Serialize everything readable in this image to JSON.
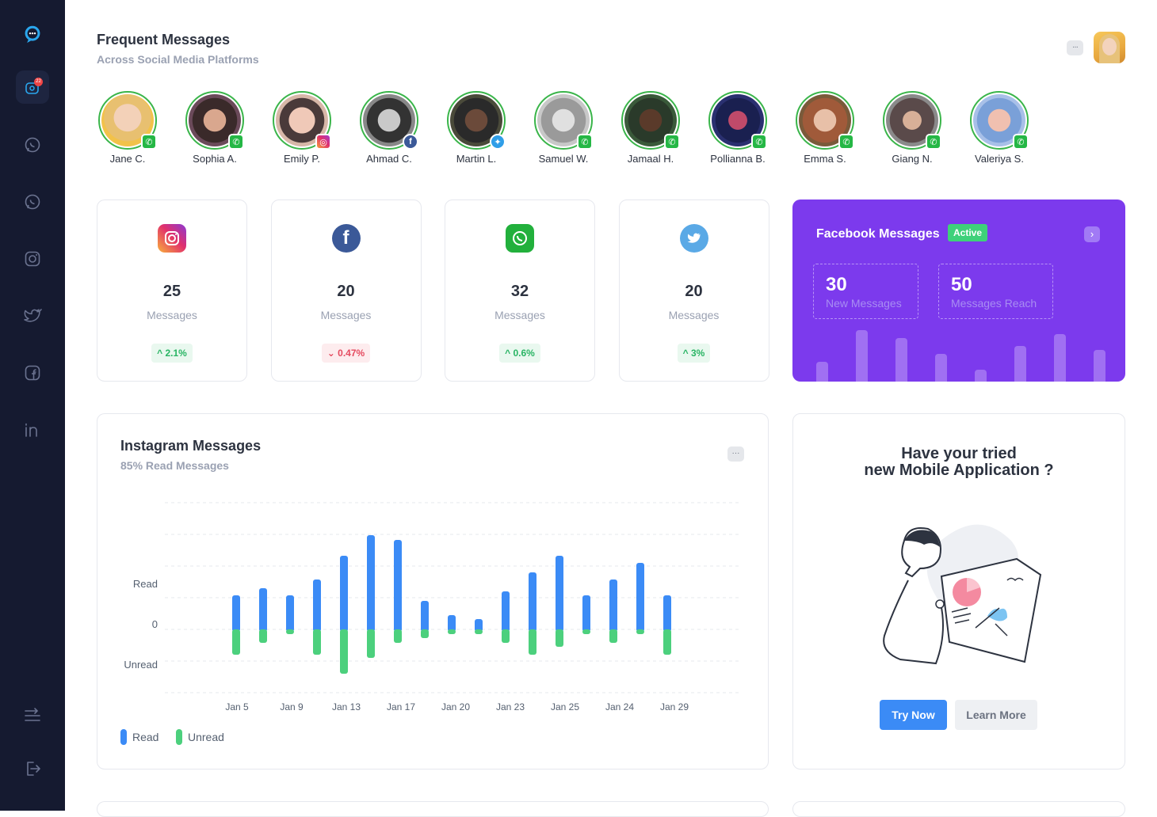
{
  "header": {
    "title": "Frequent Messages",
    "subtitle": "Across Social Media Platforms",
    "menu_label": "···"
  },
  "sidebar": {
    "notification_count": "22"
  },
  "contacts": [
    {
      "name": "Jane C.",
      "platform": "whatsapp"
    },
    {
      "name": "Sophia A.",
      "platform": "whatsapp"
    },
    {
      "name": "Emily P.",
      "platform": "instagram"
    },
    {
      "name": "Ahmad C.",
      "platform": "facebook"
    },
    {
      "name": "Martin L.",
      "platform": "twitter"
    },
    {
      "name": "Samuel W.",
      "platform": "whatsapp"
    },
    {
      "name": "Jamaal H.",
      "platform": "whatsapp"
    },
    {
      "name": "Pollianna B.",
      "platform": "whatsapp"
    },
    {
      "name": "Emma S.",
      "platform": "whatsapp"
    },
    {
      "name": "Giang N.",
      "platform": "whatsapp"
    },
    {
      "name": "Valeriya S.",
      "platform": "whatsapp"
    }
  ],
  "stats": [
    {
      "platform": "instagram",
      "count": "25",
      "label": "Messages",
      "change": "2.1%",
      "direction": "up"
    },
    {
      "platform": "facebook",
      "count": "20",
      "label": "Messages",
      "change": "0.47%",
      "direction": "down"
    },
    {
      "platform": "whatsapp",
      "count": "32",
      "label": "Messages",
      "change": "0.6%",
      "direction": "up"
    },
    {
      "platform": "twitter",
      "count": "20",
      "label": "Messages",
      "change": "3%",
      "direction": "up"
    }
  ],
  "facebook_card": {
    "title": "Facebook Messages",
    "status": "Active",
    "new_messages": "30",
    "new_messages_label": "New Messages",
    "reach": "50",
    "reach_label": "Messages Reach",
    "bars": [
      25,
      65,
      55,
      35,
      15,
      45,
      60,
      40
    ]
  },
  "chart": {
    "title": "Instagram Messages",
    "subtitle": "85% Read Messages",
    "menu_label": "···",
    "legend_read": "Read",
    "legend_unread": "Unread"
  },
  "chart_data": {
    "type": "bar",
    "x_tick_labels": [
      "Jan 5",
      "Jan 9",
      "Jan 13",
      "Jan 17",
      "Jan 20",
      "Jan 23",
      "Jan 25",
      "Jan 24",
      "Jan 29"
    ],
    "y_tick_labels": [
      "Read",
      "0",
      "Unread"
    ],
    "series": [
      {
        "name": "Read",
        "color": "#3b8bf6",
        "values": [
          43,
          52,
          43,
          63,
          93,
          119,
          113,
          36,
          18,
          13,
          48,
          72,
          93,
          43,
          63,
          84,
          43
        ]
      },
      {
        "name": "Unread",
        "color": "#4cd07d",
        "values": [
          32,
          17,
          6,
          32,
          56,
          36,
          17,
          11,
          6,
          6,
          17,
          32,
          22,
          6,
          17,
          6,
          32
        ]
      }
    ]
  },
  "promo": {
    "title_line1": "Have your tried",
    "title_line2": "new Mobile Application ?",
    "primary_button": "Try Now",
    "secondary_button": "Learn More"
  },
  "colors": {
    "sidebar": "#151a30",
    "accent": "#7c3aed",
    "read": "#3b8bf6",
    "unread": "#4cd07d",
    "contact_ring": "#3ab54a"
  }
}
